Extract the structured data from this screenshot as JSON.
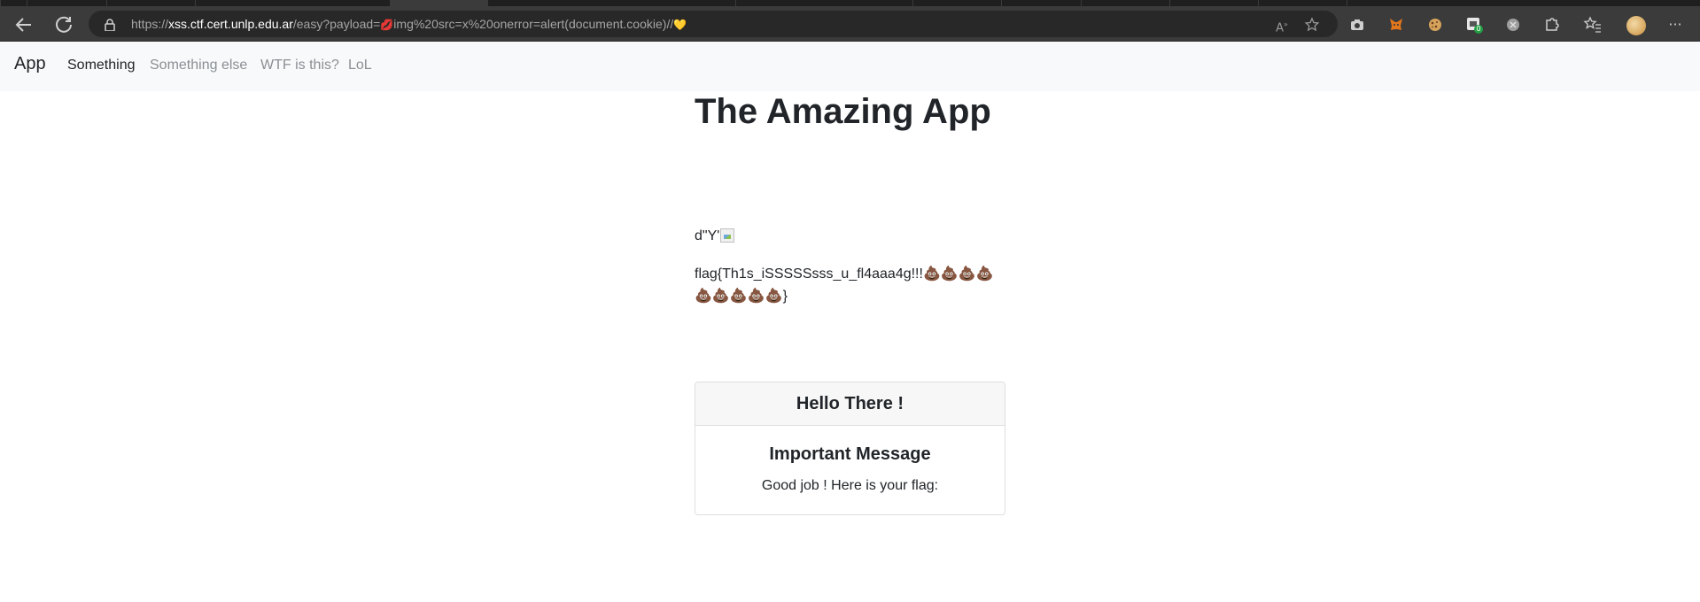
{
  "browser": {
    "url_prefix": "https://",
    "url_host": "xss.ctf.cert.unlp.edu.ar",
    "url_path_start": "/easy?payload=",
    "url_emoji_open": "💋",
    "url_path_end": "img%20src=x%20onerror=alert(document.cookie)//",
    "url_emoji_close": "💛",
    "extension_badge": "0",
    "icons": {
      "back": "back-arrow-icon",
      "refresh": "refresh-icon",
      "lock": "lock-icon",
      "read_aloud": "read-aloud-icon",
      "add_favorite": "add-favorite-icon",
      "camera": "camera-icon",
      "fox": "metamask-fox-icon",
      "cookie": "cookie-icon",
      "ext_badge": "extension-badge-icon",
      "ext_grey": "extension-grey-icon",
      "extensions": "puzzle-extensions-icon",
      "favorites": "favorites-icon",
      "profile": "profile-avatar",
      "more": "more-menu-icon"
    }
  },
  "navbar": {
    "brand": "App",
    "links": [
      "Something",
      "Something else",
      "WTF is this?",
      "LoL"
    ]
  },
  "main": {
    "title": "The Amazing App",
    "payload_text": "d\"Y'",
    "flag_text": "flag{Th1s_iSSSSSsss_u_fl4aaa4g!!!💩💩💩💩💩💩💩💩💩}"
  },
  "card": {
    "header": "Hello There !",
    "title": "Important Message",
    "text": "Good job ! Here is your flag:"
  },
  "colors": {
    "chrome_bg": "#3b3b3b",
    "addressbar_bg": "#282828",
    "navbar_bg": "#f8f9fa",
    "text": "#212529",
    "muted_link": "#8a8f94"
  }
}
